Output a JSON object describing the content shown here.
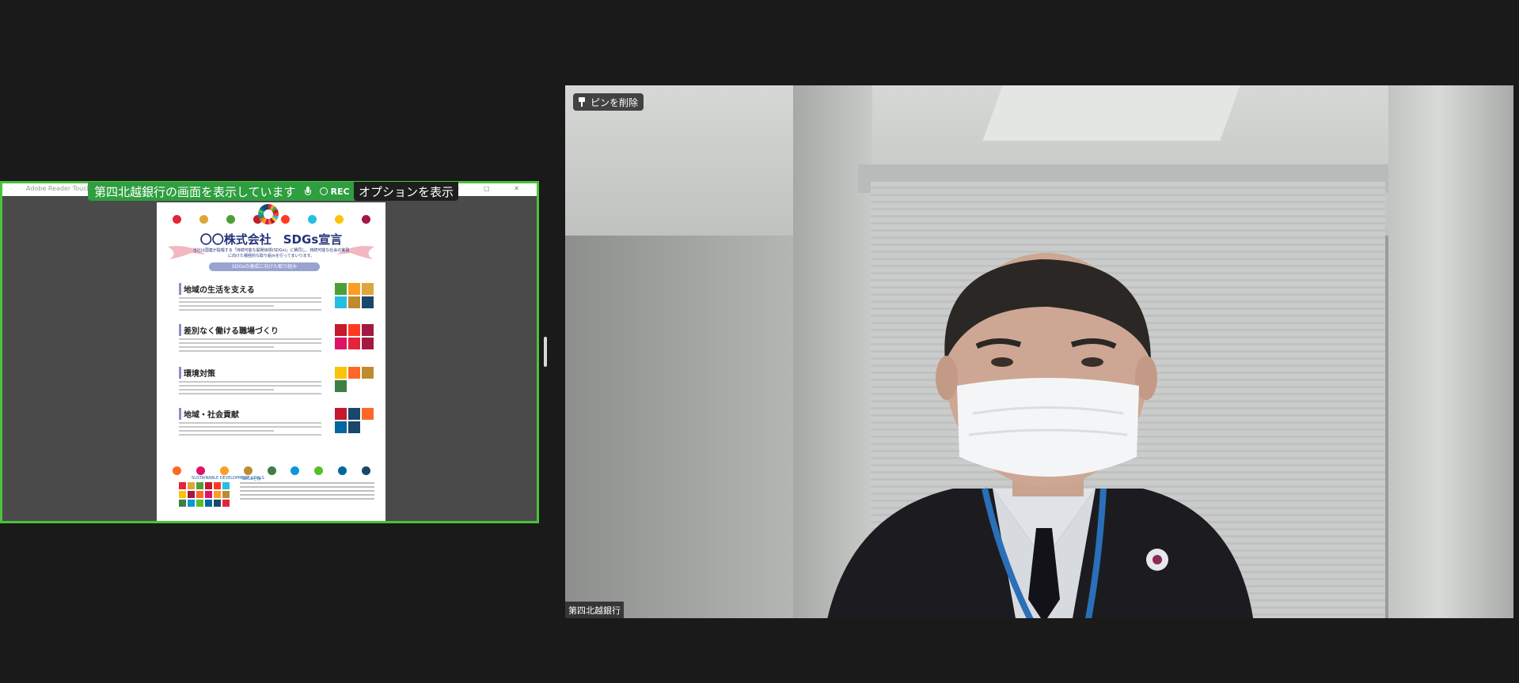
{
  "share": {
    "app_label": "Adobe Reader Touch",
    "status_text": "第四北越銀行の画面を表示しています",
    "rec_label": "REC",
    "options_label": "オプションを表示",
    "window_buttons": "— □ ✕"
  },
  "document": {
    "title": "〇〇株式会社　SDGs宣言",
    "subtitle": "当社は国連が提唱する「持続可能な開発目標(SDGs)」に賛同し、持続可能な社会の実現に向けた積極的な取り組みを行ってまいります。",
    "band_label": "SDGsの達成に向けた取り組み",
    "sections": [
      {
        "title": "地域の生活を支える"
      },
      {
        "title": "差別なく働ける職場づくり"
      },
      {
        "title": "環境対策"
      },
      {
        "title": "地域・社会貢献"
      }
    ],
    "sdgs_label": "SDGsとは",
    "goals_label": "SUSTAINABLE DEVELOPMENT GOALS",
    "top_dot_colors": [
      "#e5243b",
      "#dda63a",
      "#4c9f38",
      "#c5192d",
      "#ff3a21",
      "#26bde2",
      "#fcc30b",
      "#a21942"
    ],
    "bottom_dot_colors": [
      "#fd6925",
      "#dd1367",
      "#fd9d24",
      "#bf8b2e",
      "#3f7e44",
      "#0a97d9",
      "#56c02b",
      "#00689d",
      "#19486a"
    ]
  },
  "video": {
    "pin_label": "ピンを削除",
    "participant_name": "第四北越銀行"
  },
  "colors": {
    "share_border": "#4bc23a",
    "status_green": "#2e9e3f"
  }
}
